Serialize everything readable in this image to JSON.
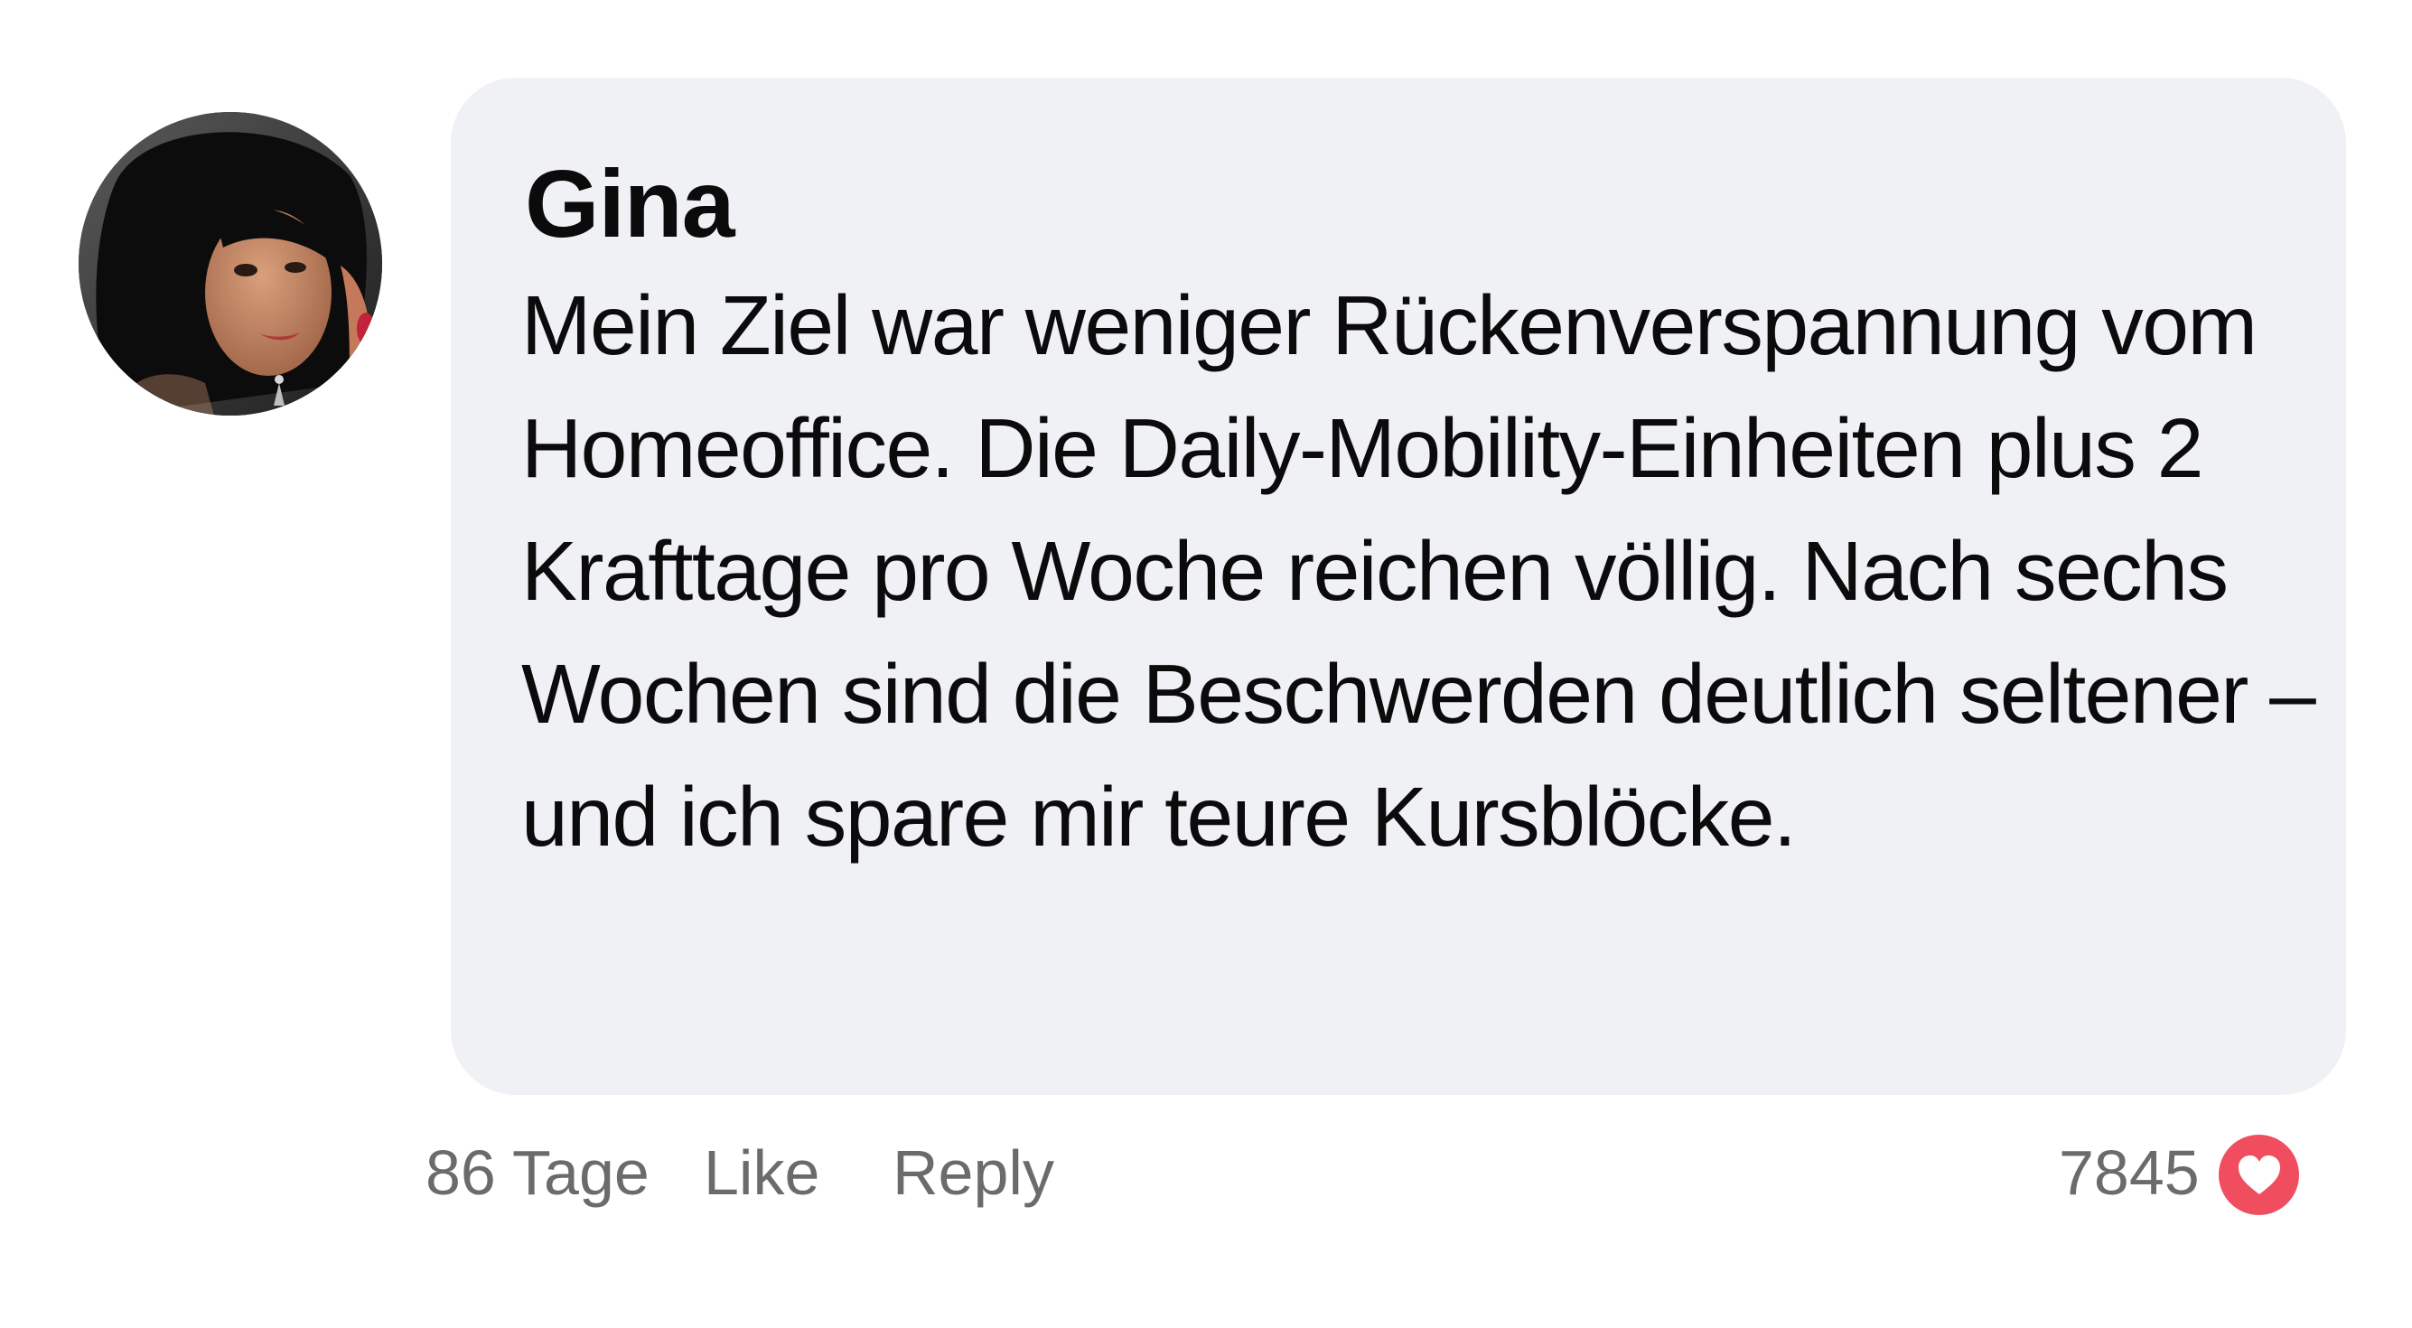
{
  "comment": {
    "author": "Gina",
    "text": "Mein Ziel war weniger Rückenverspannung vom Homeoffice. Die Daily-Mobility-Einheiten plus 2 Krafttage pro Woche reichen völlig. Nach sechs Wochen sind die Beschwerden deutlich seltener – und ich spare mir teure Kursblöcke.",
    "age": "86 Tage",
    "like_label": "Like",
    "reply_label": "Reply",
    "like_count": "7845",
    "icons": {
      "avatar": "avatar-photo",
      "like": "heart-icon"
    },
    "colors": {
      "bubble": "#f0f1f5",
      "meta_text": "#6b6b6b",
      "heart": "#f04d5f"
    }
  }
}
